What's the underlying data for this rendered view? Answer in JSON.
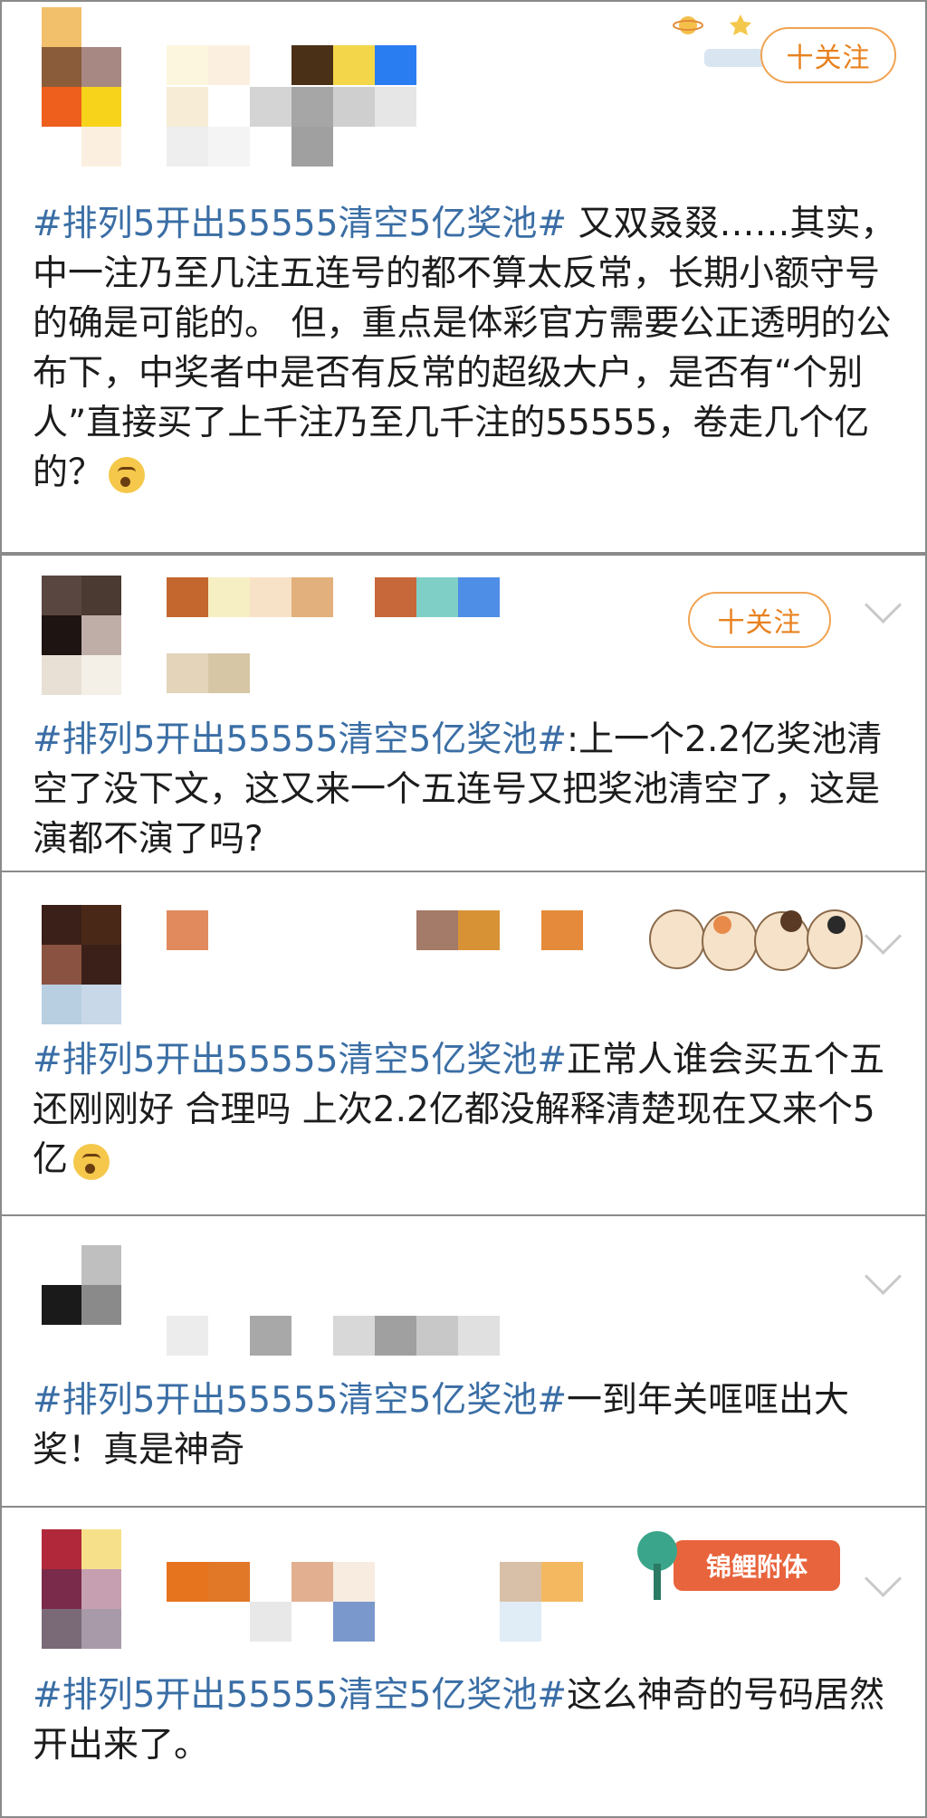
{
  "posts": [
    {
      "follow_label": "十关注",
      "hashtag": "#排列5开出55555清空5亿奖池#",
      "text": " 又双叒叕……其实，中一注乃至几注五连号的都不算太反常，长期小额守号的确是可能的。 但，重点是体彩官方需要公正透明的公布下，中奖者中是否有反常的超级大户，是否有“个别人”直接买了上千注乃至几千注的55555，卷走几个亿的？",
      "emoji": "thinking-emoji"
    },
    {
      "follow_label": "十关注",
      "hashtag": "#排列5开出55555清空5亿奖池#",
      "text": ":上一个2.2亿奖池清空了没下文，这又来一个五连号又把奖池清空了，这是演都不演了吗?"
    },
    {
      "hashtag": "#排列5开出55555清空5亿奖池#",
      "text": "正常人谁会买五个五 还刚刚好 合理吗 上次2.2亿都没解释清楚现在又来个5亿",
      "emoji": "thinking-emoji"
    },
    {
      "hashtag": "#排列5开出55555清空5亿奖池#",
      "text": "一到年关哐哐出大奖！真是神奇"
    },
    {
      "badge_label": "锦鲤附体",
      "hashtag": "#排列5开出55555清空5亿奖池#",
      "text": "这么神奇的号码居然开出来了。"
    }
  ],
  "colors": {
    "hashtag": "#3a6ea5",
    "follow": "#e8811e",
    "border": "#8a8a8a"
  },
  "icons": [
    "chevron-down-icon",
    "thinking-emoji",
    "sticker-decoration"
  ]
}
